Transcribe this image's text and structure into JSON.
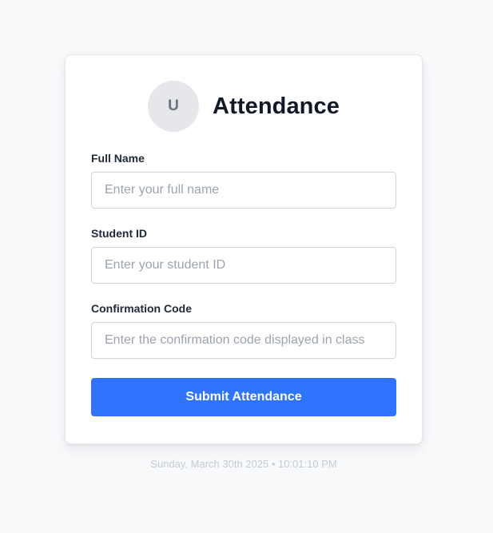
{
  "header": {
    "avatar_initial": "U",
    "title": "Attendance"
  },
  "form": {
    "fields": [
      {
        "label": "Full Name",
        "placeholder": "Enter your full name",
        "value": ""
      },
      {
        "label": "Student ID",
        "placeholder": "Enter your student ID",
        "value": ""
      },
      {
        "label": "Confirmation Code",
        "placeholder": "Enter the confirmation code displayed in class",
        "value": ""
      }
    ],
    "submit_label": "Submit Attendance"
  },
  "footer": {
    "timestamp": "Sunday, March 30th 2025 • 10:01:10 PM"
  },
  "colors": {
    "page_background": "#f8f9fb",
    "accent": "#2f74ff",
    "avatar_background": "#e5e7eb"
  }
}
